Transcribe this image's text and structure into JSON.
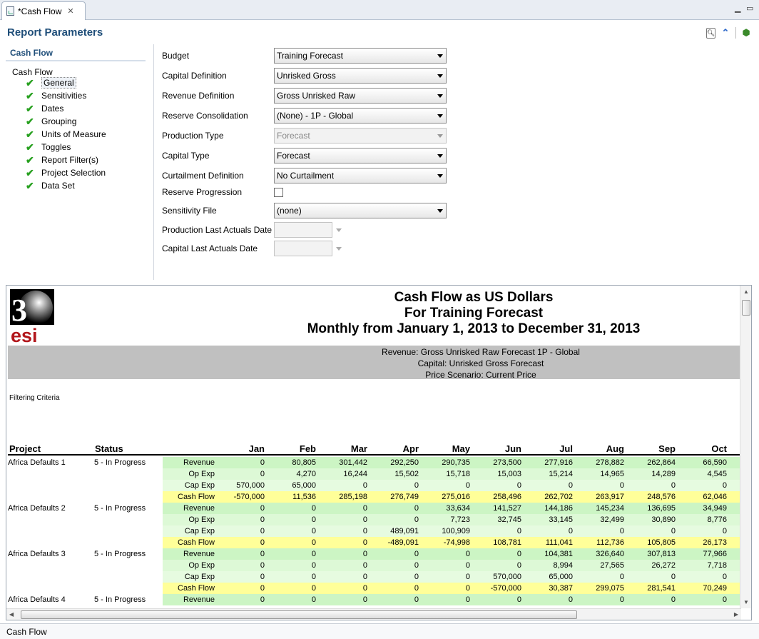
{
  "tab": {
    "title": "*Cash Flow"
  },
  "header": {
    "title": "Report Parameters"
  },
  "nav": {
    "section_title": "Cash Flow",
    "root_label": "Cash Flow",
    "items": [
      "General",
      "Sensitivities",
      "Dates",
      "Grouping",
      "Units of Measure",
      "Toggles",
      "Report Filter(s)",
      "Project Selection",
      "Data Set"
    ]
  },
  "form": {
    "budget": {
      "label": "Budget",
      "value": "Training Forecast"
    },
    "capital_definition": {
      "label": "Capital Definition",
      "value": "Unrisked Gross"
    },
    "revenue_definition": {
      "label": "Revenue Definition",
      "value": "Gross Unrisked Raw"
    },
    "reserve_consolidation": {
      "label": "Reserve Consolidation",
      "value": "(None) - 1P - Global"
    },
    "production_type": {
      "label": "Production Type",
      "value": "Forecast"
    },
    "capital_type": {
      "label": "Capital Type",
      "value": "Forecast"
    },
    "curtailment_definition": {
      "label": "Curtailment Definition",
      "value": "No Curtailment"
    },
    "reserve_progression": {
      "label": "Reserve Progression",
      "checked": false
    },
    "sensitivity_file": {
      "label": "Sensitivity File",
      "value": "(none)"
    },
    "production_last_actuals": {
      "label": "Production Last Actuals Date"
    },
    "capital_last_actuals": {
      "label": "Capital Last Actuals Date"
    }
  },
  "report": {
    "logo_text": "esi",
    "title_lines": [
      "Cash Flow as US Dollars",
      "For Training Forecast",
      "Monthly from January 1, 2013 to December 31, 2013"
    ],
    "band_lines": [
      "Revenue: Gross Unrisked Raw Forecast 1P - Global",
      "Capital: Unrisked Gross Forecast",
      "Price Scenario: Current Price"
    ],
    "filtering_label": "Filtering Criteria",
    "columns": {
      "project": "Project",
      "status": "Status",
      "months": [
        "Jan",
        "Feb",
        "Mar",
        "Apr",
        "May",
        "Jun",
        "Jul",
        "Aug",
        "Sep",
        "Oct"
      ]
    },
    "rows": [
      {
        "project": "Africa Defaults 1",
        "status": "5 - In Progress",
        "type": "Revenue",
        "values": [
          "0",
          "80,805",
          "301,442",
          "292,250",
          "290,735",
          "273,500",
          "277,916",
          "278,882",
          "262,864",
          "66,590"
        ]
      },
      {
        "project": "",
        "status": "",
        "type": "Op Exp",
        "values": [
          "0",
          "4,270",
          "16,244",
          "15,502",
          "15,718",
          "15,003",
          "15,214",
          "14,965",
          "14,289",
          "4,545"
        ]
      },
      {
        "project": "",
        "status": "",
        "type": "Cap Exp",
        "values": [
          "570,000",
          "65,000",
          "0",
          "0",
          "0",
          "0",
          "0",
          "0",
          "0",
          "0"
        ]
      },
      {
        "project": "",
        "status": "",
        "type": "Cash Flow",
        "values": [
          "-570,000",
          "11,536",
          "285,198",
          "276,749",
          "275,016",
          "258,496",
          "262,702",
          "263,917",
          "248,576",
          "62,046"
        ]
      },
      {
        "project": "Africa Defaults 2",
        "status": "5 - In Progress",
        "type": "Revenue",
        "values": [
          "0",
          "0",
          "0",
          "0",
          "33,634",
          "141,527",
          "144,186",
          "145,234",
          "136,695",
          "34,949"
        ]
      },
      {
        "project": "",
        "status": "",
        "type": "Op Exp",
        "values": [
          "0",
          "0",
          "0",
          "0",
          "7,723",
          "32,745",
          "33,145",
          "32,499",
          "30,890",
          "8,776"
        ]
      },
      {
        "project": "",
        "status": "",
        "type": "Cap Exp",
        "values": [
          "0",
          "0",
          "0",
          "489,091",
          "100,909",
          "0",
          "0",
          "0",
          "0",
          "0"
        ]
      },
      {
        "project": "",
        "status": "",
        "type": "Cash Flow",
        "values": [
          "0",
          "0",
          "0",
          "-489,091",
          "-74,998",
          "108,781",
          "111,041",
          "112,736",
          "105,805",
          "26,173"
        ]
      },
      {
        "project": "Africa Defaults 3",
        "status": "5 - In Progress",
        "type": "Revenue",
        "values": [
          "0",
          "0",
          "0",
          "0",
          "0",
          "0",
          "104,381",
          "326,640",
          "307,813",
          "77,966"
        ]
      },
      {
        "project": "",
        "status": "",
        "type": "Op Exp",
        "values": [
          "0",
          "0",
          "0",
          "0",
          "0",
          "0",
          "8,994",
          "27,565",
          "26,272",
          "7,718"
        ]
      },
      {
        "project": "",
        "status": "",
        "type": "Cap Exp",
        "values": [
          "0",
          "0",
          "0",
          "0",
          "0",
          "570,000",
          "65,000",
          "0",
          "0",
          "0"
        ]
      },
      {
        "project": "",
        "status": "",
        "type": "Cash Flow",
        "values": [
          "0",
          "0",
          "0",
          "0",
          "0",
          "-570,000",
          "30,387",
          "299,075",
          "281,541",
          "70,249"
        ]
      },
      {
        "project": "Africa Defaults 4",
        "status": "5 - In Progress",
        "type": "Revenue",
        "values": [
          "0",
          "0",
          "0",
          "0",
          "0",
          "0",
          "0",
          "0",
          "0",
          "0"
        ]
      }
    ]
  },
  "statusbar": {
    "text": "Cash Flow"
  },
  "colors": {
    "revenue": "#ccf5c4",
    "opexp": "#ddf9d6",
    "capexp": "#e6fbe0",
    "cashflow": "#ffff99",
    "title_blue": "#1f4e79"
  }
}
